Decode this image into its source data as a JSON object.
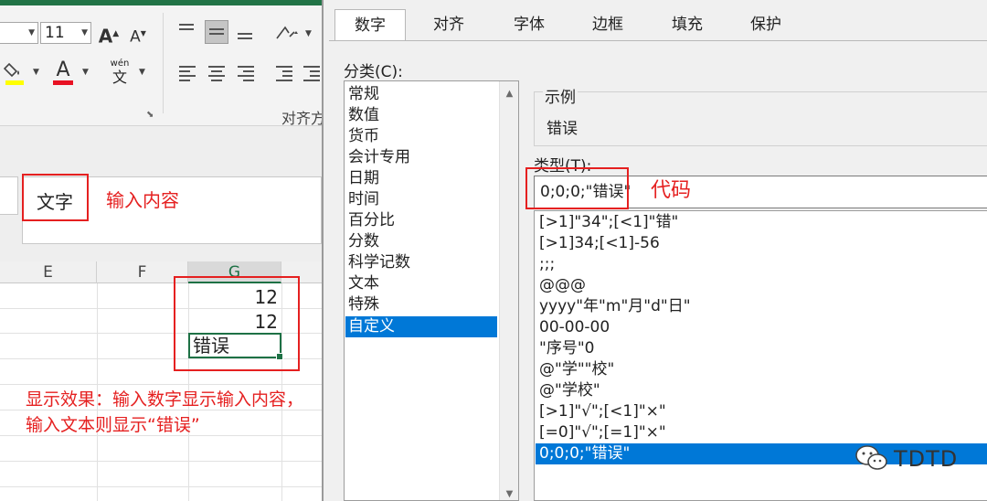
{
  "ribbon": {
    "font_size": "11",
    "increase_font_icon": "A",
    "decrease_font_icon": "A",
    "font_color_icon": "A",
    "phonetic_top": "wén",
    "phonetic_bottom": "文",
    "alignment_group_label": "对齐方",
    "font_color_underline": "#e81123",
    "fill_color_underline": "#ffff00"
  },
  "formula_bar": {
    "content": "文字"
  },
  "annotations": {
    "input_content": "输入内容",
    "code": "代码",
    "effect_line1": "显示效果：输入数字显示输入内容，",
    "effect_line2": "输入文本则显示“错误”",
    "highlight_color": "#e52020"
  },
  "sheet": {
    "columns": [
      "E",
      "F",
      "G"
    ],
    "cells": [
      "12",
      "12",
      "错误"
    ]
  },
  "dialog": {
    "tabs": [
      "数字",
      "对齐",
      "字体",
      "边框",
      "填充",
      "保护"
    ],
    "active_tab": "数字",
    "category_label": "分类(C):",
    "categories": [
      "常规",
      "数值",
      "货币",
      "会计专用",
      "日期",
      "时间",
      "百分比",
      "分数",
      "科学记数",
      "文本",
      "特殊",
      "自定义"
    ],
    "selected_category": "自定义",
    "sample_label": "示例",
    "sample_value": "错误",
    "type_label": "类型(T):",
    "type_value": "0;0;0;\"错误\"",
    "formats": [
      "[>1]\"34\";[<1]\"错\"",
      "[>1]34;[<1]-56",
      ";;;",
      "@@@",
      "yyyy\"年\"m\"月\"d\"日\"",
      "00-00-00",
      "\"序号\"0",
      "@\"学\"\"校\"",
      "@\"学校\"",
      "[>1]\"√\";[<1]\"×\"",
      "[=0]\"√\";[=1]\"×\"",
      "0;0;0;\"错误\""
    ],
    "selected_color": "#0078d7"
  },
  "watermark": {
    "text": "TDTD",
    "icon": "wechat-icon"
  }
}
